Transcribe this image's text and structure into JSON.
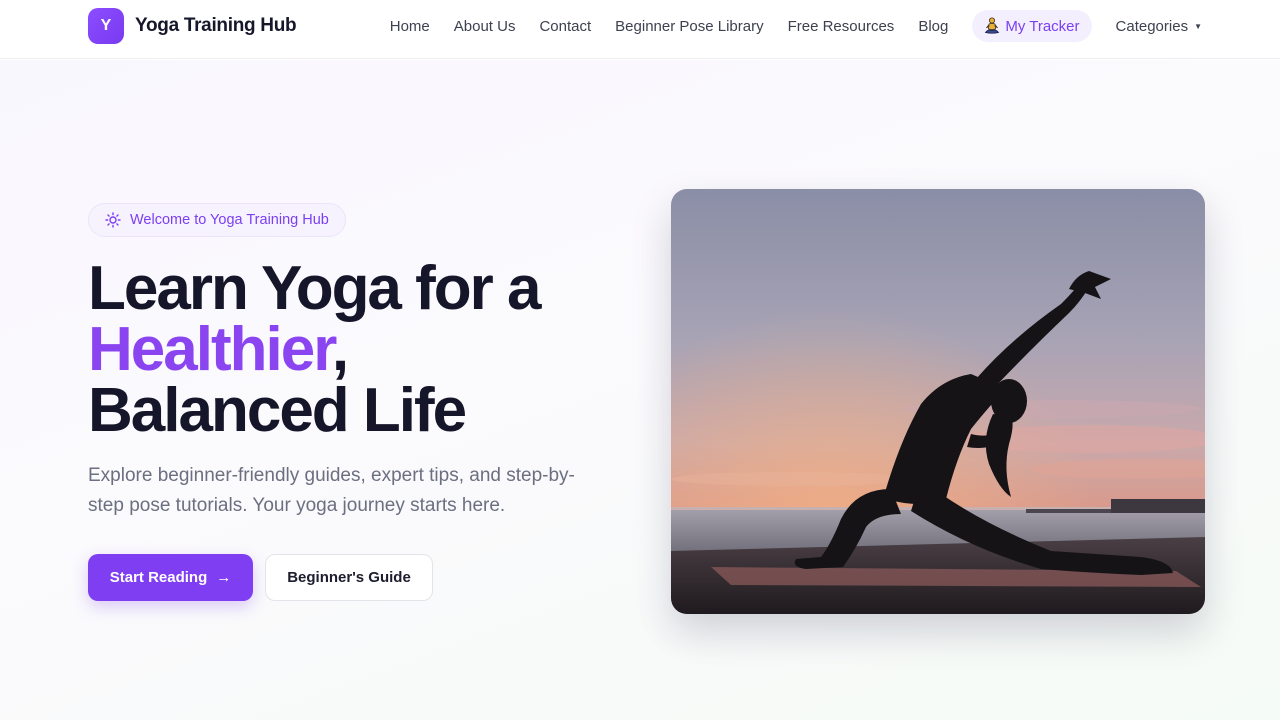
{
  "brand": {
    "logo_letter": "Y",
    "name": "Yoga Training Hub",
    "accent_color": "#7b3ff2"
  },
  "nav": {
    "items": [
      {
        "label": "Home"
      },
      {
        "label": "About Us"
      },
      {
        "label": "Contact"
      },
      {
        "label": "Beginner Pose Library"
      },
      {
        "label": "Free Resources"
      },
      {
        "label": "Blog"
      }
    ],
    "tracker": {
      "label": "My Tracker",
      "icon": "meditation-icon"
    },
    "categories": {
      "label": "Categories",
      "icon": "caret-down-icon"
    }
  },
  "hero": {
    "badge": {
      "label": "Welcome to Yoga Training Hub",
      "icon": "sun-icon"
    },
    "headline": {
      "line1": "Learn Yoga for a",
      "accent": "Healthier",
      "accent_suffix": ",",
      "line3": "Balanced Life"
    },
    "subtitle": "Explore beginner-friendly guides, expert tips, and step-by-step pose tutorials. Your yoga journey starts here.",
    "primary_button": {
      "label": "Start Reading",
      "icon": "arrow-right-icon"
    },
    "secondary_button": {
      "label": "Beginner's Guide"
    },
    "image": {
      "subject": "yoga-pose-silhouette-at-sunset"
    }
  }
}
